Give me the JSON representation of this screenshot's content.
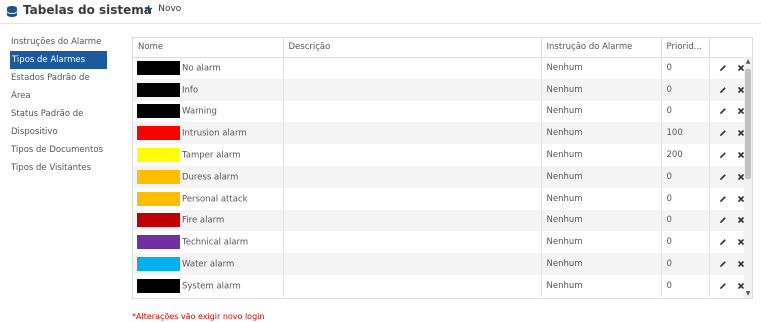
{
  "header": {
    "title": "Tabelas do sistema",
    "new_label": "Novo"
  },
  "sidebar": {
    "items": [
      {
        "label": "Instruções do Alarme"
      },
      {
        "label": "Tipos de Alarmes"
      },
      {
        "label": "Estados Padrão de Área"
      },
      {
        "label": "Status Padrão de Dispositivo"
      },
      {
        "label": "Tipos de Documentos"
      },
      {
        "label": "Tipos de Visitantes"
      }
    ],
    "active_index": 1
  },
  "table": {
    "columns": [
      "Nome",
      "Descrição",
      "Instrução do Alarme",
      "Priorid..."
    ],
    "rows": [
      {
        "color": "#000000",
        "name": "No alarm",
        "description": "",
        "instruction": "Nenhum",
        "priority": "0"
      },
      {
        "color": "#000000",
        "name": "Info",
        "description": "",
        "instruction": "Nenhum",
        "priority": "0"
      },
      {
        "color": "#000000",
        "name": "Warning",
        "description": "",
        "instruction": "Nenhum",
        "priority": "0"
      },
      {
        "color": "#ff0000",
        "name": "Intrusion alarm",
        "description": "",
        "instruction": "Nenhum",
        "priority": "100"
      },
      {
        "color": "#ffff00",
        "name": "Tamper alarm",
        "description": "",
        "instruction": "Nenhum",
        "priority": "200"
      },
      {
        "color": "#ffbf00",
        "name": "Duress alarm",
        "description": "",
        "instruction": "Nenhum",
        "priority": "0"
      },
      {
        "color": "#ffbf00",
        "name": "Personal attack",
        "description": "",
        "instruction": "Nenhum",
        "priority": "0"
      },
      {
        "color": "#c00000",
        "name": "Fire alarm",
        "description": "",
        "instruction": "Nenhum",
        "priority": "0"
      },
      {
        "color": "#7030a0",
        "name": "Technical alarm",
        "description": "",
        "instruction": "Nenhum",
        "priority": "0"
      },
      {
        "color": "#00b0f0",
        "name": "Water alarm",
        "description": "",
        "instruction": "Nenhum",
        "priority": "0"
      },
      {
        "color": "#000000",
        "name": "System alarm",
        "description": "",
        "instruction": "Nenhum",
        "priority": "0"
      }
    ]
  },
  "icons": {
    "edit": "pencil-icon",
    "delete": "close-icon",
    "app": "database-icon",
    "new": "plus-icon"
  },
  "accent_color": "#1c5a9e",
  "footnote": "*Alterações vão exigir novo login"
}
